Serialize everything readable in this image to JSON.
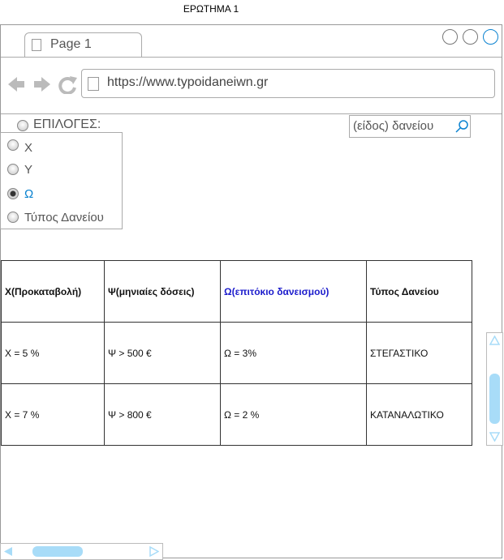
{
  "caption": "ΕΡΩΤΗΜΑ 1",
  "browser": {
    "tab_label": "Page 1",
    "url": "https://www.typoidaneiwn.gr"
  },
  "options": {
    "label": "ΕΠΙΛΟΓΕΣ:",
    "items": [
      {
        "label": "Χ",
        "checked": false
      },
      {
        "label": "Υ",
        "checked": false
      },
      {
        "label": "Ω",
        "checked": true
      },
      {
        "label": "Τύπος Δανείου",
        "checked": false
      }
    ]
  },
  "search": {
    "text": "(είδος) δανείου"
  },
  "table": {
    "headers": [
      "Χ(Προκαταβολή)",
      "Ψ(μηνιαίες δόσεις)",
      "Ω(επιτόκιο δανεισμού)",
      "Τύπος Δανείου"
    ],
    "rows": [
      [
        "X = 5 %",
        "Ψ > 500 €",
        "Ω = 3%",
        "ΣΤΕΓΑΣΤΙΚΟ"
      ],
      [
        "X = 7 %",
        "Ψ > 800 €",
        "Ω = 2 %",
        "ΚΑΤΑΝΑΛΩΤΙΚΟ"
      ]
    ]
  },
  "colors": {
    "accent": "#0a82d0",
    "header_highlight": "#1b1bcc",
    "scroll_thumb": "#a8dcf8"
  }
}
